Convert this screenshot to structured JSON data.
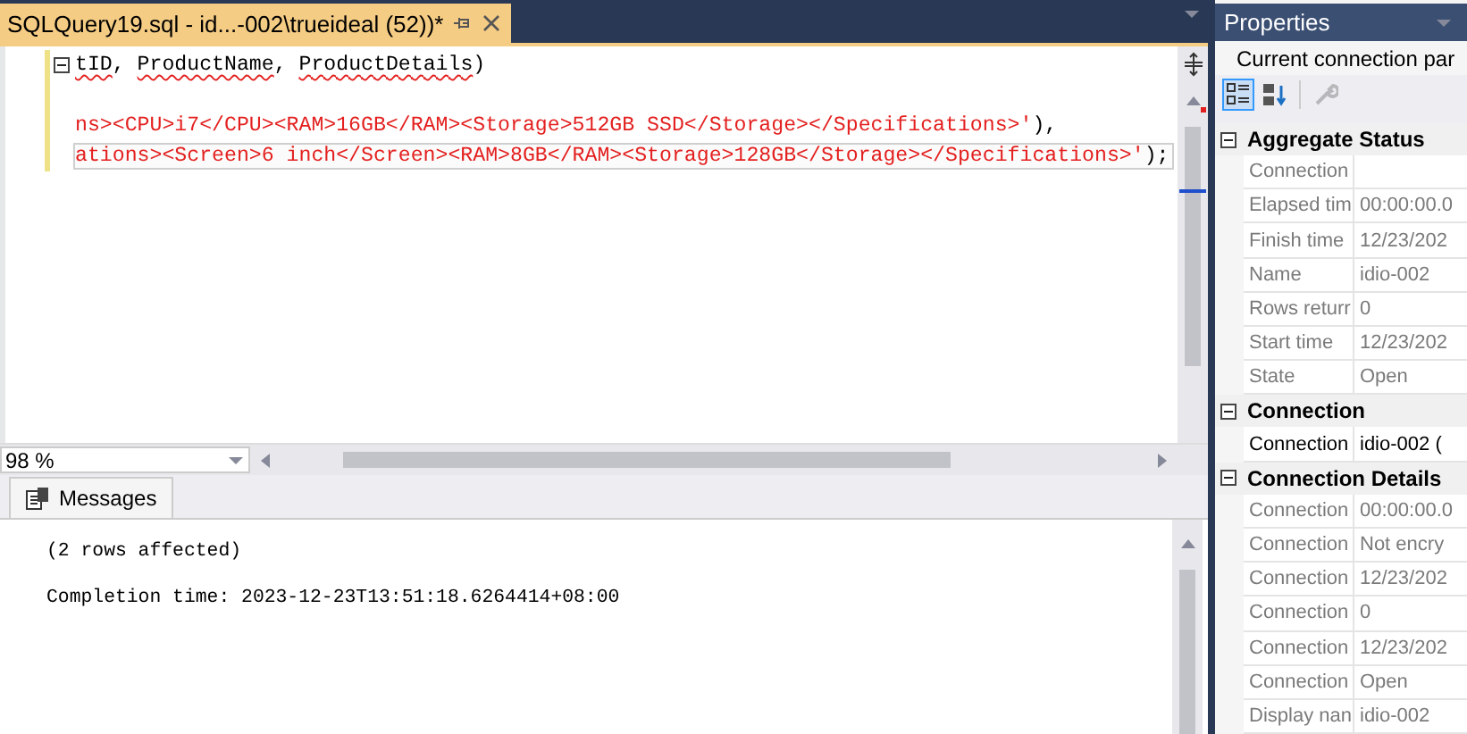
{
  "editor_tab": {
    "title": "SQLQuery19.sql - id...-002\\trueideal (52))*",
    "selected": true
  },
  "editor": {
    "lines": [
      {
        "kind": "code",
        "collapse": true,
        "changed": true,
        "current": false,
        "tokens": [
          {
            "text": "tID",
            "kind": "error"
          },
          {
            "text": ", ",
            "kind": "plain"
          },
          {
            "text": "ProductName",
            "kind": "error"
          },
          {
            "text": ", ",
            "kind": "plain"
          },
          {
            "text": "ProductDetails",
            "kind": "error"
          },
          {
            "text": ")",
            "kind": "plain"
          }
        ]
      },
      {
        "kind": "blank",
        "changed": true
      },
      {
        "kind": "code",
        "collapse": false,
        "changed": true,
        "current": false,
        "tokens": [
          {
            "text": "ns><CPU>i7</CPU><RAM>16GB</RAM><Storage>512GB SSD</Storage></Specifications>'",
            "kind": "string"
          },
          {
            "text": "),",
            "kind": "plain"
          }
        ]
      },
      {
        "kind": "code",
        "collapse": false,
        "changed": true,
        "current": true,
        "tokens": [
          {
            "text": "ations><Screen>6 inch</Screen><RAM>8GB</RAM><Storage>128GB</Storage></Specifications>'",
            "kind": "string"
          },
          {
            "text": ");",
            "kind": "plain"
          }
        ]
      }
    ]
  },
  "zoom": "98 %",
  "results_tabs": [
    {
      "label": "Messages",
      "selected": true
    }
  ],
  "messages": [
    "(2 rows affected)",
    "Completion time: 2023-12-23T13:51:18.6264414+08:00"
  ],
  "properties": {
    "title": "Properties",
    "object": "Current connection par",
    "toolbar": [
      {
        "kind": "categorized",
        "selected": true,
        "disabled": false
      },
      {
        "kind": "alphabetical",
        "selected": false,
        "disabled": false
      },
      {
        "kind": "property-pages",
        "selected": false,
        "disabled": true
      }
    ],
    "categories": [
      {
        "name": "Aggregate Status",
        "expanded": true,
        "rows": [
          {
            "name": "Connection",
            "readonly": true
          },
          {
            "name": "Elapsed tim",
            "value": "00:00:00.0",
            "readonly": true
          },
          {
            "name": "Finish time",
            "value": "12/23/202",
            "readonly": true
          },
          {
            "name": "Name",
            "value": "idio-002",
            "readonly": true
          },
          {
            "name": "Rows returr",
            "value": "0",
            "readonly": true
          },
          {
            "name": "Start time",
            "value": "12/23/202",
            "readonly": true
          },
          {
            "name": "State",
            "value": "Open",
            "readonly": true
          }
        ]
      },
      {
        "name": "Connection",
        "expanded": true,
        "rows": [
          {
            "name": "Connection",
            "value": "idio-002 (",
            "readonly": false
          }
        ]
      },
      {
        "name": "Connection Details",
        "expanded": true,
        "rows": [
          {
            "name": "Connection",
            "value": "00:00:00.0",
            "readonly": true
          },
          {
            "name": "Connection",
            "value": "Not encry",
            "readonly": true
          },
          {
            "name": "Connection",
            "value": "12/23/202",
            "readonly": true
          },
          {
            "name": "Connection",
            "value": "0",
            "readonly": true
          },
          {
            "name": "Connection",
            "value": "12/23/202",
            "readonly": true
          },
          {
            "name": "Connection",
            "value": "Open",
            "readonly": true
          },
          {
            "name": "Display nan",
            "value": "idio-002",
            "readonly": true
          }
        ]
      }
    ]
  }
}
